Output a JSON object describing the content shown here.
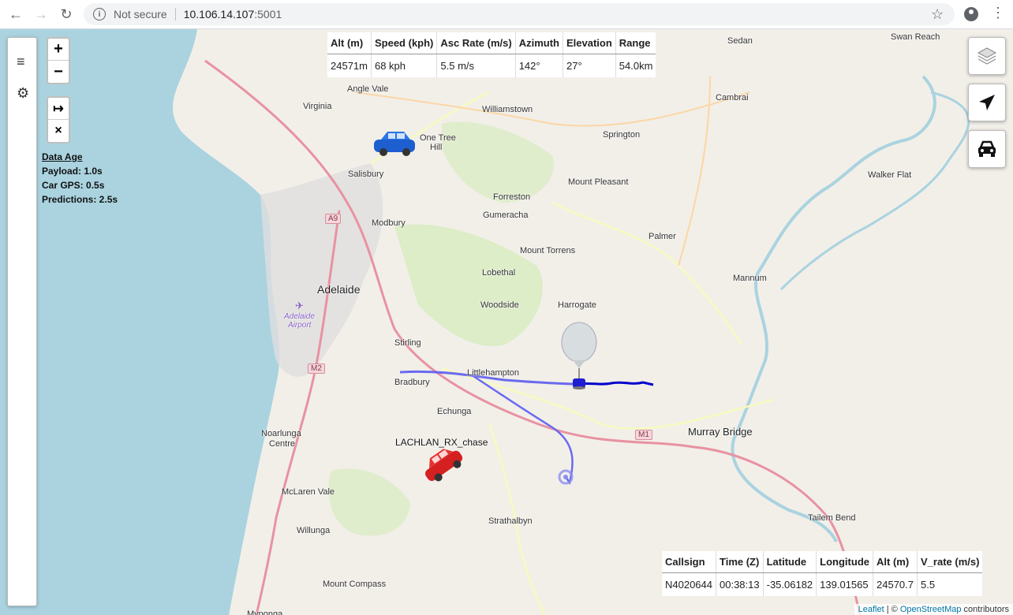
{
  "browser": {
    "url_host": "10.106.14.107",
    "url_port": ":5001",
    "security_label": "Not secure"
  },
  "map": {
    "places": [
      {
        "name": "Virginia",
        "cls": "place"
      },
      {
        "name": "Angle Vale",
        "cls": "place"
      },
      {
        "name": "Williamstown",
        "cls": "place"
      },
      {
        "name": "Sedan",
        "cls": "place"
      },
      {
        "name": "Swan Reach",
        "cls": "place"
      },
      {
        "name": "Cambrai",
        "cls": "place"
      },
      {
        "name": "One Tree",
        "cls": "place"
      },
      {
        "name": "Hill",
        "cls": "place"
      },
      {
        "name": "Springton",
        "cls": "place"
      },
      {
        "name": "Salisbury",
        "cls": "place"
      },
      {
        "name": "Mount Pleasant",
        "cls": "place"
      },
      {
        "name": "Walker Flat",
        "cls": "place"
      },
      {
        "name": "Forreston",
        "cls": "place"
      },
      {
        "name": "Gumeracha",
        "cls": "place"
      },
      {
        "name": "Modbury",
        "cls": "place"
      },
      {
        "name": "Palmer",
        "cls": "place"
      },
      {
        "name": "Mount Torrens",
        "cls": "place"
      },
      {
        "name": "Lobethal",
        "cls": "place"
      },
      {
        "name": "Mannum",
        "cls": "place"
      },
      {
        "name": "Adelaide",
        "cls": "place big"
      },
      {
        "name": "Woodside",
        "cls": "place"
      },
      {
        "name": "Harrogate",
        "cls": "place"
      },
      {
        "name": "Adelaide",
        "cls": "place airport"
      },
      {
        "name": "Airport",
        "cls": "place airport"
      },
      {
        "name": "Stirling",
        "cls": "place"
      },
      {
        "name": "Littlehampton",
        "cls": "place"
      },
      {
        "name": "Bradbury",
        "cls": "place"
      },
      {
        "name": "Echunga",
        "cls": "place"
      },
      {
        "name": "Murray Bridge",
        "cls": "place mid"
      },
      {
        "name": "Noarlunga",
        "cls": "place"
      },
      {
        "name": "Centre",
        "cls": "place"
      },
      {
        "name": "McLaren Vale",
        "cls": "place"
      },
      {
        "name": "Strathalbyn",
        "cls": "place"
      },
      {
        "name": "Tailem Bend",
        "cls": "place"
      },
      {
        "name": "Willunga",
        "cls": "place"
      },
      {
        "name": "Mount Compass",
        "cls": "place"
      },
      {
        "name": "Myponga",
        "cls": "place"
      }
    ],
    "shields": [
      "A9",
      "M2",
      "M1"
    ]
  },
  "sidebar": {
    "menu_icon": "≡",
    "settings_icon": "⚙"
  },
  "zoom": {
    "in": "+",
    "out": "−",
    "follow": "↦",
    "clear": "×"
  },
  "data_age": {
    "heading": "Data Age",
    "payload": "Payload: 1.0s",
    "car_gps": "Car GPS: 0.5s",
    "predictions": "Predictions: 2.5s"
  },
  "telemetry_table": {
    "headers": [
      "Alt (m)",
      "Speed (kph)",
      "Asc Rate (m/s)",
      "Azimuth",
      "Elevation",
      "Range"
    ],
    "values": [
      "24571m",
      "68 kph",
      "5.5 m/s",
      "142°",
      "27°",
      "54.0km"
    ]
  },
  "payload_table": {
    "headers": [
      "Callsign",
      "Time (Z)",
      "Latitude",
      "Longitude",
      "Alt (m)",
      "V_rate (m/s)"
    ],
    "values": [
      "N4020644",
      "00:38:13",
      "-35.06182",
      "139.01565",
      "24570.7",
      "5.5"
    ]
  },
  "chase_car_label": "LACHLAN_RX_chase",
  "attribution": {
    "leaflet": "Leaflet",
    "sep": " | © ",
    "osm": "OpenStreetMap",
    "contrib": " contributors"
  }
}
